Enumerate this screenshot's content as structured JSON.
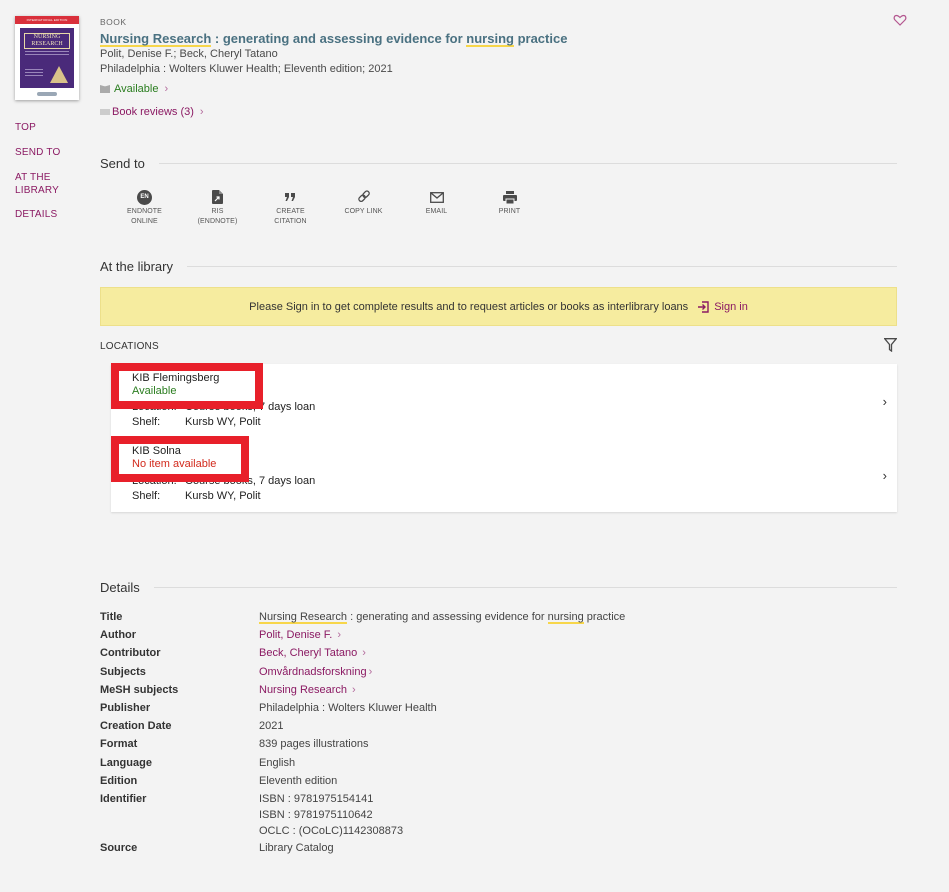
{
  "record": {
    "type": "BOOK",
    "title_highlight_1": "Nursing Research",
    "title_mid": " : generating and assessing evidence for ",
    "title_highlight_2": "nursing",
    "title_end": " practice",
    "authors": "Polit, Denise F.; Beck, Cheryl Tatano",
    "publication": "Philadelphia : Wolters Kluwer Health; Eleventh edition; 2021",
    "availability": "Available",
    "reviews": "Book reviews (3)",
    "cover_band_text": "INTERNATIONAL EDITION",
    "cover_title": "NURSING RESEARCH"
  },
  "side_nav": [
    "TOP",
    "SEND TO",
    "AT THE LIBRARY",
    "DETAILS"
  ],
  "send_to": {
    "heading": "Send to",
    "actions": [
      {
        "icon": "endnote-icon",
        "badge": "EN",
        "label_1": "ENDNOTE",
        "label_2": "ONLINE"
      },
      {
        "icon": "file-export-icon",
        "label_1": "RIS",
        "label_2": "(ENDNOTE)"
      },
      {
        "icon": "quote-icon",
        "label_1": "CREATE",
        "label_2": "CITATION"
      },
      {
        "icon": "link-icon",
        "label_1": "COPY LINK",
        "label_2": ""
      },
      {
        "icon": "email-icon",
        "label_1": "EMAIL",
        "label_2": ""
      },
      {
        "icon": "print-icon",
        "label_1": "PRINT",
        "label_2": ""
      }
    ]
  },
  "library": {
    "heading": "At the library",
    "banner_text": "Please Sign in to get complete results and to request articles or books as interlibrary loans",
    "signin_label": "Sign in",
    "locations_label": "LOCATIONS",
    "locations": [
      {
        "name": "KIB Flemingsberg",
        "status": "Available",
        "location_key": "Location:",
        "location_value": "Course books, 7 days loan",
        "shelf_key": "Shelf:",
        "shelf_value": "Kursb WY, Polit"
      },
      {
        "name": "KIB Solna",
        "status": "No item available",
        "location_key": "Location:",
        "location_value": "Course books, 7 days loan",
        "shelf_key": "Shelf:",
        "shelf_value": "Kursb WY, Polit"
      }
    ]
  },
  "details": {
    "heading": "Details",
    "title_key": "Title",
    "author_key": "Author",
    "author_value": "Polit, Denise F.",
    "contributor_key": "Contributor",
    "contributor_value": "Beck, Cheryl Tatano",
    "subjects_key": "Subjects",
    "subjects_value": "Omvårdnadsforskning",
    "mesh_key": "MeSH subjects",
    "mesh_value": "Nursing Research",
    "publisher_key": "Publisher",
    "publisher_value": "Philadelphia : Wolters Kluwer Health",
    "creation_key": "Creation Date",
    "creation_value": "2021",
    "format_key": "Format",
    "format_value": "839 pages illustrations",
    "language_key": "Language",
    "language_value": "English",
    "edition_key": "Edition",
    "edition_value": "Eleventh edition",
    "identifier_key": "Identifier",
    "identifiers": [
      "ISBN : 9781975154141",
      "ISBN : 9781975110642",
      "OCLC : (OCoLC)1142308873"
    ],
    "source_key": "Source",
    "source_value": "Library Catalog"
  },
  "colors": {
    "accent": "#8b1a63",
    "title": "#4a7181",
    "available": "#2a7d1f",
    "unavailable": "#d22a1c",
    "banner": "#f6ec9f",
    "highlight": "#f7d64a",
    "annotation_box": "#e8202a"
  }
}
